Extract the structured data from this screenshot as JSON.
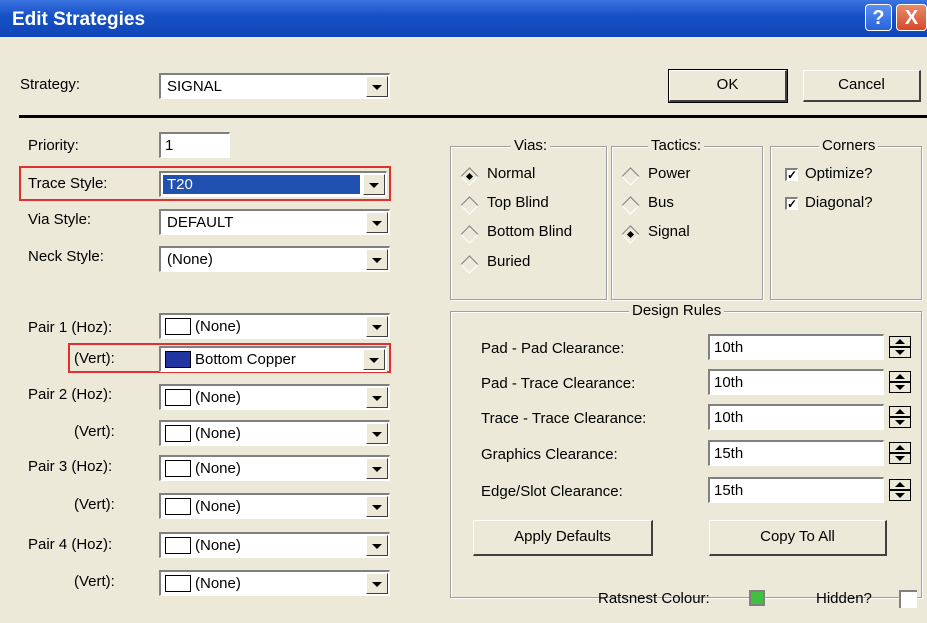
{
  "window": {
    "title": "Edit Strategies",
    "help_label": "?",
    "close_label": "X"
  },
  "strategy": {
    "label": "Strategy:",
    "value": "SIGNAL"
  },
  "buttons": {
    "ok": "OK",
    "cancel": "Cancel",
    "apply_defaults": "Apply Defaults",
    "copy_to_all": "Copy To All"
  },
  "priority": {
    "label": "Priority:",
    "value": "1"
  },
  "trace_style": {
    "label": "Trace Style:",
    "value": "T20"
  },
  "via_style": {
    "label": "Via Style:",
    "value": "DEFAULT"
  },
  "neck_style": {
    "label": "Neck Style:",
    "value": "(None)"
  },
  "pairs": [
    {
      "hoz_label": "Pair 1 (Hoz):",
      "hoz_value": "(None)",
      "vert_label": "(Vert):",
      "vert_value": "Bottom Copper",
      "vert_color": "#2035a0"
    },
    {
      "hoz_label": "Pair 2 (Hoz):",
      "hoz_value": "(None)",
      "vert_label": "(Vert):",
      "vert_value": "(None)"
    },
    {
      "hoz_label": "Pair 3 (Hoz):",
      "hoz_value": "(None)",
      "vert_label": "(Vert):",
      "vert_value": "(None)"
    },
    {
      "hoz_label": "Pair 4 (Hoz):",
      "hoz_value": "(None)",
      "vert_label": "(Vert):",
      "vert_value": "(None)"
    }
  ],
  "vias": {
    "title": "Vias:",
    "options": [
      "Normal",
      "Top Blind",
      "Bottom Blind",
      "Buried"
    ],
    "selected": "Normal"
  },
  "tactics": {
    "title": "Tactics:",
    "options": [
      "Power",
      "Bus",
      "Signal"
    ],
    "selected": "Signal"
  },
  "corners": {
    "title": "Corners",
    "options": [
      {
        "label": "Optimize?",
        "checked": true
      },
      {
        "label": "Diagonal?",
        "checked": true
      }
    ]
  },
  "design_rules": {
    "title": "Design Rules",
    "rules": [
      {
        "label": "Pad - Pad Clearance:",
        "value": "10th"
      },
      {
        "label": "Pad - Trace Clearance:",
        "value": "10th"
      },
      {
        "label": "Trace - Trace Clearance:",
        "value": "10th"
      },
      {
        "label": "Graphics Clearance:",
        "value": "15th"
      },
      {
        "label": "Edge/Slot Clearance:",
        "value": "15th"
      }
    ]
  },
  "ratsnest": {
    "label": "Ratsnest Colour:",
    "color": "#40c040"
  },
  "hidden": {
    "label": "Hidden?",
    "checked": false
  },
  "colors": {
    "title_bar": "#1852c8",
    "dialog_bg": "#ece9d8",
    "highlight": "#e03030",
    "selection": "#2050b0"
  }
}
